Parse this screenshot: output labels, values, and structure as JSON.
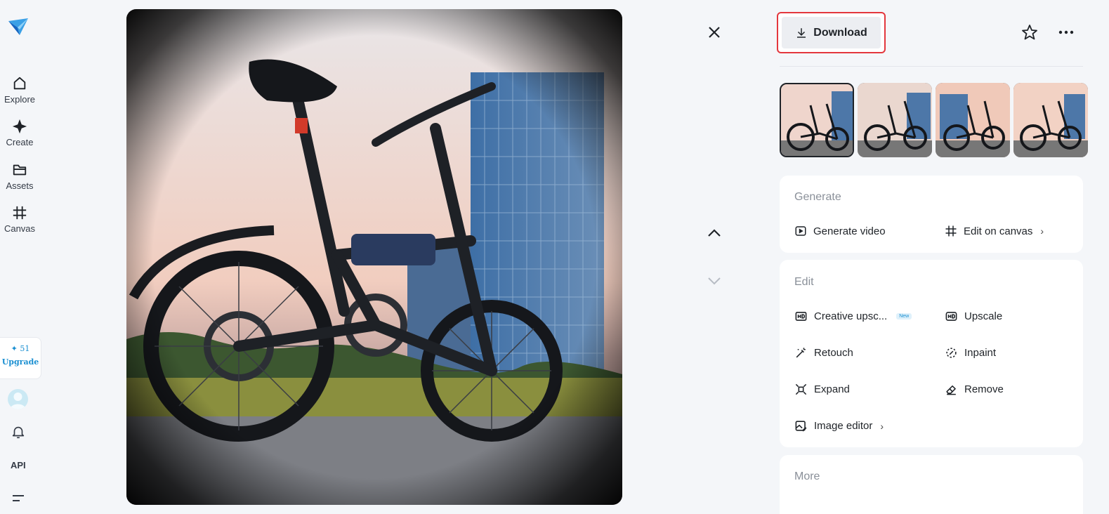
{
  "nav": {
    "items": [
      {
        "label": "Explore",
        "icon": "home-icon"
      },
      {
        "label": "Create",
        "icon": "sparkle-icon"
      },
      {
        "label": "Assets",
        "icon": "folder-icon"
      },
      {
        "label": "Canvas",
        "icon": "canvas-icon"
      }
    ],
    "credits": "✦ 51",
    "upgrade_label": "Upgrade",
    "api_label": "API"
  },
  "toolbar": {
    "download_label": "Download"
  },
  "sections": {
    "generate": {
      "title": "Generate",
      "actions": [
        {
          "label": "Generate video",
          "icon": "play-icon"
        },
        {
          "label": "Edit on canvas",
          "icon": "canvas-icon"
        }
      ]
    },
    "edit": {
      "title": "Edit",
      "actions": [
        {
          "label": "Creative upsc...",
          "icon": "hd-plus-icon",
          "badge": "New"
        },
        {
          "label": "Upscale",
          "icon": "hd-icon"
        },
        {
          "label": "Retouch",
          "icon": "wand-icon"
        },
        {
          "label": "Inpaint",
          "icon": "inpaint-icon"
        },
        {
          "label": "Expand",
          "icon": "expand-icon"
        },
        {
          "label": "Remove",
          "icon": "eraser-icon"
        },
        {
          "label": "Image editor",
          "icon": "image-edit-icon"
        }
      ]
    },
    "more": {
      "title": "More"
    }
  },
  "colors": {
    "accent": "#1a8fd1",
    "highlight_border": "#e3373d",
    "background": "#f4f6f9"
  }
}
